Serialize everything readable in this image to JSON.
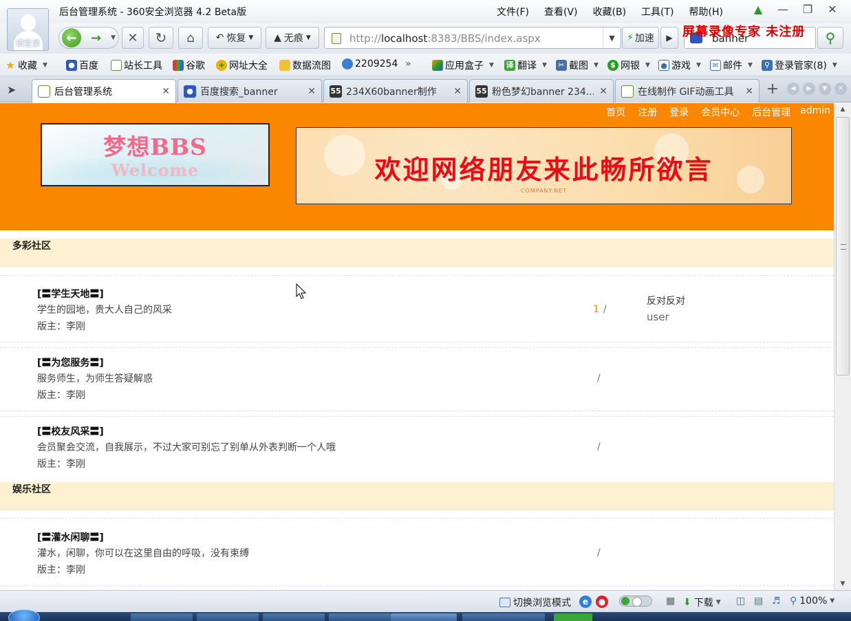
{
  "browser": {
    "window_title": "后台管理系统 - 360安全浏览器 4.2 Beta版",
    "avatar_label": "请登录",
    "menu": [
      "文件(F)",
      "查看(V)",
      "收藏(B)",
      "工具(T)",
      "帮助(H)"
    ],
    "nav": {
      "restore_label": "恢复",
      "incognito_label": "无痕",
      "address_prefix": "http://",
      "address_host": "localhost",
      "address_rest": ":8383/BBS/index.aspx",
      "accelerate_label": "加速",
      "search_value": "banner"
    },
    "watermark": "屏幕录像专家  未注册",
    "bookmarks": [
      {
        "label": "收藏",
        "icon": "star-icon",
        "dropdown": true
      },
      {
        "label": "百度",
        "icon": "baidu-paw-icon"
      },
      {
        "label": "站长工具",
        "icon": "page-icon"
      },
      {
        "label": "谷歌",
        "icon": "google-icon"
      },
      {
        "label": "网址大全",
        "icon": "plus-globe-icon"
      },
      {
        "label": "数据流图",
        "icon": "folder-icon"
      },
      {
        "label": "2209254",
        "icon": "globe-icon"
      },
      {
        "label": "应用盒子",
        "icon": "cube-icon",
        "dropdown": true
      },
      {
        "label": "翻译",
        "icon": "translate-icon",
        "dropdown": true
      },
      {
        "label": "截图",
        "icon": "screenshot-icon",
        "dropdown": true
      },
      {
        "label": "网银",
        "icon": "bank-icon",
        "dropdown": true
      },
      {
        "label": "游戏",
        "icon": "game-icon",
        "dropdown": true
      },
      {
        "label": "邮件",
        "icon": "mail-icon",
        "dropdown": true
      },
      {
        "label": "登录管家(8)",
        "icon": "key-icon",
        "dropdown": true
      }
    ],
    "tabs": [
      {
        "label": "后台管理系统",
        "icon": "page-icon",
        "active": true
      },
      {
        "label": "百度搜索_banner",
        "icon": "baidu-paw-icon",
        "active": false
      },
      {
        "label": "234X60banner制作",
        "icon": "site55-icon",
        "active": false
      },
      {
        "label": "粉色梦幻banner 234...",
        "icon": "site55-icon",
        "active": false
      },
      {
        "label": "在线制作 GIF动画工具",
        "icon": "page-icon",
        "active": false
      }
    ],
    "status": {
      "mode_label": "切换浏览模式",
      "download_label": "下载",
      "zoom": "100%"
    }
  },
  "page": {
    "top_nav": [
      "首页",
      "注册",
      "登录",
      "会员中心",
      "后台管理"
    ],
    "current_user": "admin",
    "logo": {
      "title": "梦想BBS",
      "subtitle": "Welcome"
    },
    "ad_banner": {
      "slogan": "欢迎网络朋友来此畅所欲言",
      "brand": "COMPANY.NET"
    },
    "categories": [
      {
        "title": "多彩社区",
        "forums": [
          {
            "name": "[〓学生天地〓]",
            "desc": "学生的园地，贵大人自己的风采",
            "moderator": "版主：李刚",
            "count": "1",
            "sep": "/",
            "last_title": "反对反对",
            "last_user": "user"
          },
          {
            "name": "[〓为您服务〓]",
            "desc": "服务师生，为师生答疑解惑",
            "moderator": "版主：李刚",
            "count": "",
            "sep": "/",
            "last_title": "",
            "last_user": ""
          },
          {
            "name": "[〓校友风采〓]",
            "desc": "会员聚会交流，自我展示，不过大家可别忘了别单从外表判断一个人哦",
            "moderator": "版主：李刚",
            "count": "",
            "sep": "/",
            "last_title": "",
            "last_user": ""
          }
        ]
      },
      {
        "title": "娱乐社区",
        "forums": [
          {
            "name": "[〓灌水闲聊〓]",
            "desc": "灌水，闲聊，你可以在这里自由的呼吸，没有束缚",
            "moderator": "版主：李刚",
            "count": "",
            "sep": "/",
            "last_title": "",
            "last_user": ""
          }
        ]
      }
    ]
  },
  "colors": {
    "banner_orange": "#fb8600",
    "category_bg": "#fdf1d1",
    "slogan_red": "#ee0a14",
    "count_orange": "#f08c00",
    "watermark_red": "#e00000"
  }
}
